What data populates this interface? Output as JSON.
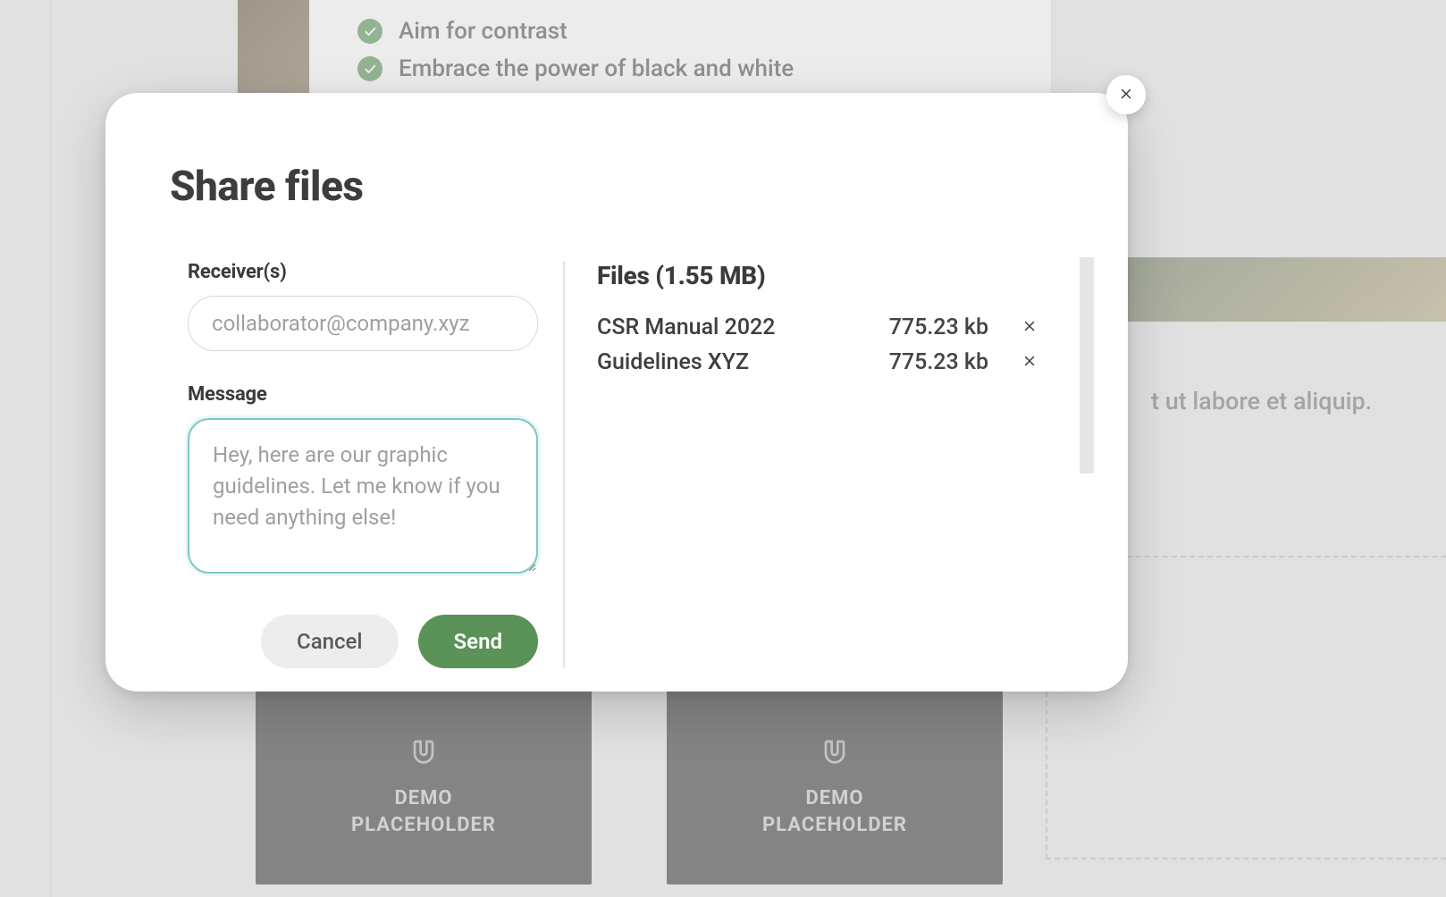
{
  "background": {
    "bullets": [
      "Aim for contrast",
      "Embrace the power of black and white"
    ],
    "lorem": "t ut labore et aliquip.",
    "thumb_label": "DEMO\nPLACEHOLDER"
  },
  "modal": {
    "title": "Share files",
    "receivers": {
      "label": "Receiver(s)",
      "placeholder": "collaborator@company.xyz",
      "value": ""
    },
    "message": {
      "label": "Message",
      "placeholder": "Hey, here are our graphic guidelines. Let me know if you need anything else!",
      "value": ""
    },
    "buttons": {
      "cancel": "Cancel",
      "send": "Send"
    },
    "files": {
      "header_label": "Files",
      "total_size": "1.55 MB",
      "items": [
        {
          "name": "CSR Manual 2022",
          "size": "775.23 kb"
        },
        {
          "name": "Guidelines XYZ",
          "size": "775.23 kb"
        }
      ]
    }
  }
}
